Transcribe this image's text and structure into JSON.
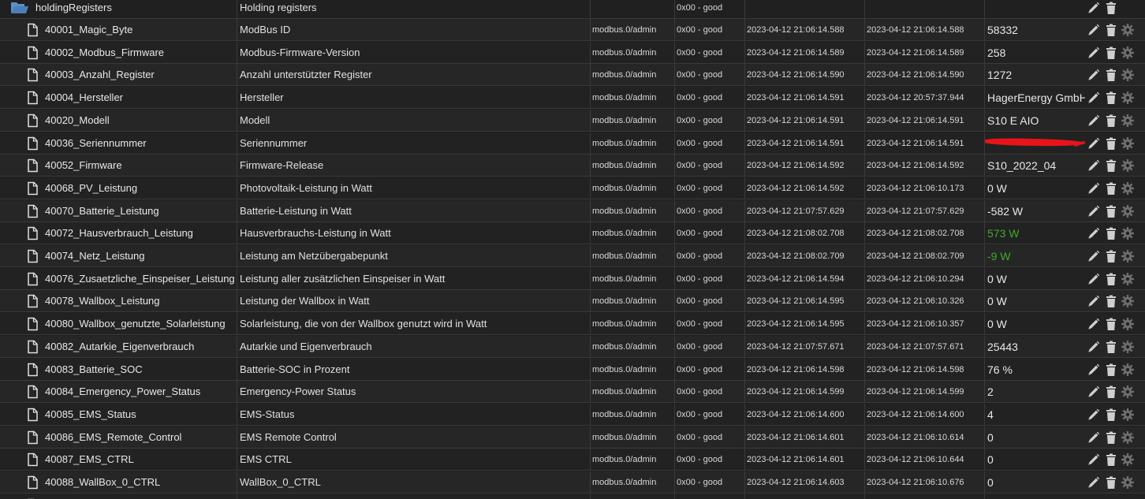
{
  "folder": {
    "name": "holdingRegisters",
    "description": "Holding registers",
    "quality": "0x00 - good"
  },
  "rows": [
    {
      "name": "40001_Magic_Byte",
      "description": "ModBus ID",
      "from": "modbus.0/admin",
      "quality": "0x00 - good",
      "ts": "2023-04-12 21:06:14.588",
      "lc": "2023-04-12 21:06:14.588",
      "value": "58332"
    },
    {
      "name": "40002_Modbus_Firmware",
      "description": "Modbus-Firmware-Version",
      "from": "modbus.0/admin",
      "quality": "0x00 - good",
      "ts": "2023-04-12 21:06:14.589",
      "lc": "2023-04-12 21:06:14.589",
      "value": "258"
    },
    {
      "name": "40003_Anzahl_Register",
      "description": "Anzahl unterstützter Register",
      "from": "modbus.0/admin",
      "quality": "0x00 - good",
      "ts": "2023-04-12 21:06:14.590",
      "lc": "2023-04-12 21:06:14.590",
      "value": "1272"
    },
    {
      "name": "40004_Hersteller",
      "description": "Hersteller",
      "from": "modbus.0/admin",
      "quality": "0x00 - good",
      "ts": "2023-04-12 21:06:14.591",
      "lc": "2023-04-12 20:57:37.944",
      "value": "HagerEnergy GmbH"
    },
    {
      "name": "40020_Modell",
      "description": "Modell",
      "from": "modbus.0/admin",
      "quality": "0x00 - good",
      "ts": "2023-04-12 21:06:14.591",
      "lc": "2023-04-12 21:06:14.591",
      "value": "S10 E AIO"
    },
    {
      "name": "40036_Seriennummer",
      "description": "Seriennummer",
      "from": "modbus.0/admin",
      "quality": "0x00 - good",
      "ts": "2023-04-12 21:06:14.591",
      "lc": "2023-04-12 21:06:14.591",
      "value": "",
      "redacted": true
    },
    {
      "name": "40052_Firmware",
      "description": "Firmware-Release",
      "from": "modbus.0/admin",
      "quality": "0x00 - good",
      "ts": "2023-04-12 21:06:14.592",
      "lc": "2023-04-12 21:06:14.592",
      "value": "S10_2022_04"
    },
    {
      "name": "40068_PV_Leistung",
      "description": "Photovoltaik-Leistung in Watt",
      "from": "modbus.0/admin",
      "quality": "0x00 - good",
      "ts": "2023-04-12 21:06:14.592",
      "lc": "2023-04-12 21:06:10.173",
      "value": "0 W"
    },
    {
      "name": "40070_Batterie_Leistung",
      "description": "Batterie-Leistung in Watt",
      "from": "modbus.0/admin",
      "quality": "0x00 - good",
      "ts": "2023-04-12 21:07:57.629",
      "lc": "2023-04-12 21:07:57.629",
      "value": "-582 W"
    },
    {
      "name": "40072_Hausverbrauch_Leistung",
      "description": "Hausverbrauchs-Leistung in Watt",
      "from": "modbus.0/admin",
      "quality": "0x00 - good",
      "ts": "2023-04-12 21:08:02.708",
      "lc": "2023-04-12 21:08:02.708",
      "value": "573 W",
      "highlight": true
    },
    {
      "name": "40074_Netz_Leistung",
      "description": "Leistung am Netzübergabepunkt",
      "from": "modbus.0/admin",
      "quality": "0x00 - good",
      "ts": "2023-04-12 21:08:02.709",
      "lc": "2023-04-12 21:08:02.709",
      "value": "-9 W",
      "highlight": true
    },
    {
      "name": "40076_Zusaetzliche_Einspeiser_Leistung",
      "description": "Leistung aller zusätzlichen Einspeiser in Watt",
      "from": "modbus.0/admin",
      "quality": "0x00 - good",
      "ts": "2023-04-12 21:06:14.594",
      "lc": "2023-04-12 21:06:10.294",
      "value": "0 W"
    },
    {
      "name": "40078_Wallbox_Leistung",
      "description": "Leistung der Wallbox in Watt",
      "from": "modbus.0/admin",
      "quality": "0x00 - good",
      "ts": "2023-04-12 21:06:14.595",
      "lc": "2023-04-12 21:06:10.326",
      "value": "0 W"
    },
    {
      "name": "40080_Wallbox_genutzte_Solarleistung",
      "description": "Solarleistung, die von der Wallbox genutzt wird in Watt",
      "from": "modbus.0/admin",
      "quality": "0x00 - good",
      "ts": "2023-04-12 21:06:14.595",
      "lc": "2023-04-12 21:06:10.357",
      "value": "0 W"
    },
    {
      "name": "40082_Autarkie_Eigenverbrauch",
      "description": "Autarkie und Eigenverbrauch",
      "from": "modbus.0/admin",
      "quality": "0x00 - good",
      "ts": "2023-04-12 21:07:57.671",
      "lc": "2023-04-12 21:07:57.671",
      "value": "25443"
    },
    {
      "name": "40083_Batterie_SOC",
      "description": "Batterie-SOC in Prozent",
      "from": "modbus.0/admin",
      "quality": "0x00 - good",
      "ts": "2023-04-12 21:06:14.598",
      "lc": "2023-04-12 21:06:14.598",
      "value": "76 %"
    },
    {
      "name": "40084_Emergency_Power_Status",
      "description": "Emergency-Power Status",
      "from": "modbus.0/admin",
      "quality": "0x00 - good",
      "ts": "2023-04-12 21:06:14.599",
      "lc": "2023-04-12 21:06:14.599",
      "value": "2"
    },
    {
      "name": "40085_EMS_Status",
      "description": "EMS-Status",
      "from": "modbus.0/admin",
      "quality": "0x00 - good",
      "ts": "2023-04-12 21:06:14.600",
      "lc": "2023-04-12 21:06:14.600",
      "value": "4"
    },
    {
      "name": "40086_EMS_Remote_Control",
      "description": "EMS Remote Control",
      "from": "modbus.0/admin",
      "quality": "0x00 - good",
      "ts": "2023-04-12 21:06:14.601",
      "lc": "2023-04-12 21:06:10.614",
      "value": "0"
    },
    {
      "name": "40087_EMS_CTRL",
      "description": "EMS CTRL",
      "from": "modbus.0/admin",
      "quality": "0x00 - good",
      "ts": "2023-04-12 21:06:14.601",
      "lc": "2023-04-12 21:06:10.644",
      "value": "0"
    },
    {
      "name": "40088_WallBox_0_CTRL",
      "description": "WallBox_0_CTRL",
      "from": "modbus.0/admin",
      "quality": "0x00 - good",
      "ts": "2023-04-12 21:06:14.603",
      "lc": "2023-04-12 21:06:10.676",
      "value": "0"
    },
    {
      "name": "",
      "description": "",
      "from": "",
      "quality": "",
      "ts": "",
      "lc": "",
      "value": ""
    }
  ],
  "colors": {
    "background": "#1f1f1f",
    "row_border": "#3a3a3a",
    "text": "#e6e6e6",
    "value_highlight": "#3faa2a",
    "redaction": "#e8141a",
    "folder_icon": "#5b8fc7",
    "action_icon": "#cfcfcf",
    "gear_icon": "#6e6e6e"
  },
  "icons": {
    "folder": "folder-open-icon",
    "file": "file-icon",
    "edit": "pencil-icon",
    "delete": "trash-icon",
    "settings": "gear-icon"
  }
}
